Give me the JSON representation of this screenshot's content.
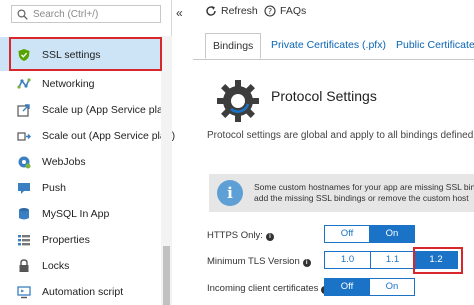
{
  "search": {
    "placeholder": "Search (Ctrl+/)"
  },
  "sidebar": {
    "collapse_glyph": "«",
    "items": [
      {
        "label": "SSL settings",
        "icon": "shield-icon",
        "selected": true
      },
      {
        "label": "Networking",
        "icon": "network-icon"
      },
      {
        "label": "Scale up (App Service plan)",
        "icon": "scale-up-icon"
      },
      {
        "label": "Scale out (App Service plan)",
        "icon": "scale-out-icon"
      },
      {
        "label": "WebJobs",
        "icon": "webjobs-icon"
      },
      {
        "label": "Push",
        "icon": "push-icon"
      },
      {
        "label": "MySQL In App",
        "icon": "mysql-icon"
      },
      {
        "label": "Properties",
        "icon": "properties-icon"
      },
      {
        "label": "Locks",
        "icon": "lock-icon"
      },
      {
        "label": "Automation script",
        "icon": "automation-icon"
      }
    ]
  },
  "toolbar": {
    "refresh_label": "Refresh",
    "faqs_label": "FAQs"
  },
  "tabs": [
    {
      "label": "Bindings",
      "active": true
    },
    {
      "label": "Private Certificates (.pfx)"
    },
    {
      "label": "Public Certificates"
    }
  ],
  "main": {
    "title": "Protocol Settings",
    "description": "Protocol settings are global and apply to all bindings defined",
    "info_line1": "Some custom hostnames for your app are missing SSL bin",
    "info_line2": "add the missing SSL bindings or remove the custom host"
  },
  "settings": {
    "https_only": {
      "label": "HTTPS Only:",
      "options": [
        "Off",
        "On"
      ],
      "selected": "On"
    },
    "min_tls": {
      "label": "Minimum TLS Version",
      "options": [
        "1.0",
        "1.1",
        "1.2"
      ],
      "selected": "1.2"
    },
    "client_certs": {
      "label": "Incoming client certificates",
      "options": [
        "Off",
        "On"
      ],
      "selected": "Off"
    }
  },
  "colors": {
    "accent": "#1a73c7",
    "highlight": "#d9262b",
    "selected_bg": "#cce4f6"
  }
}
